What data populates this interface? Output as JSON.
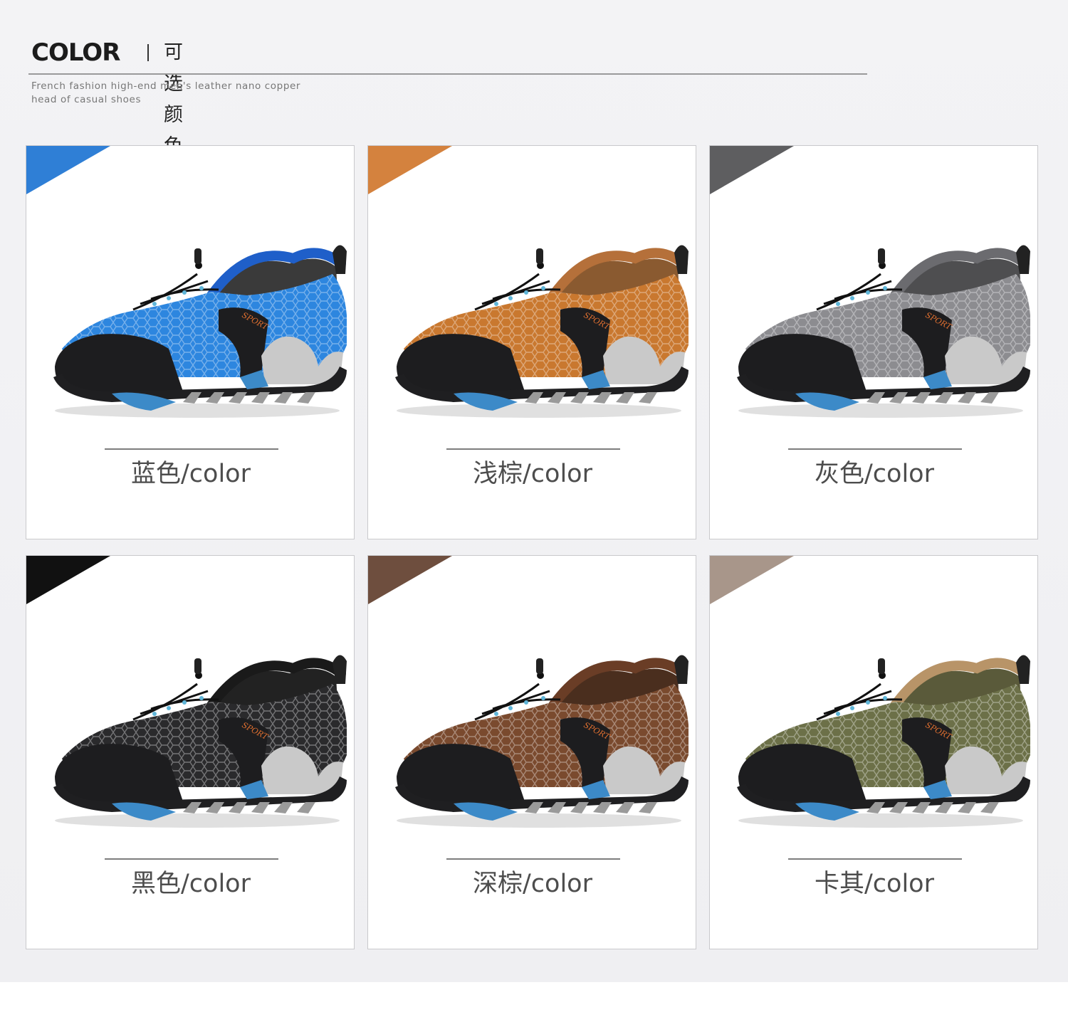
{
  "header": {
    "title_en": "COLOR",
    "title_cn": "可选颜色",
    "subtitle_line1": "French fashion high-end men's leather nano copper",
    "subtitle_line2": "head of casual shoes"
  },
  "variants": [
    {
      "label": "蓝色/color",
      "tag_color": "#2f7fd6",
      "mesh_color": "#2d86df",
      "collar_color": "#1f5fc9",
      "inner_color": "#3a3a3a"
    },
    {
      "label": "浅棕/color",
      "tag_color": "#d4823e",
      "mesh_color": "#c9782f",
      "collar_color": "#b5703a",
      "inner_color": "#8a5a30"
    },
    {
      "label": "灰色/color",
      "tag_color": "#5e5e60",
      "mesh_color": "#8c8c90",
      "collar_color": "#6b6b6f",
      "inner_color": "#4e4e50"
    },
    {
      "label": "黑色/color",
      "tag_color": "#111111",
      "mesh_color": "#2a2a2c",
      "collar_color": "#1a1a1a",
      "inner_color": "#222222"
    },
    {
      "label": "深棕/color",
      "tag_color": "#6e4e3e",
      "mesh_color": "#7a4a2e",
      "collar_color": "#6a3d26",
      "inner_color": "#4a2e1e"
    },
    {
      "label": "卡其/color",
      "tag_color": "#a8968a",
      "mesh_color": "#6c7048",
      "collar_color": "#b89468",
      "inner_color": "#5a5a3a"
    }
  ]
}
